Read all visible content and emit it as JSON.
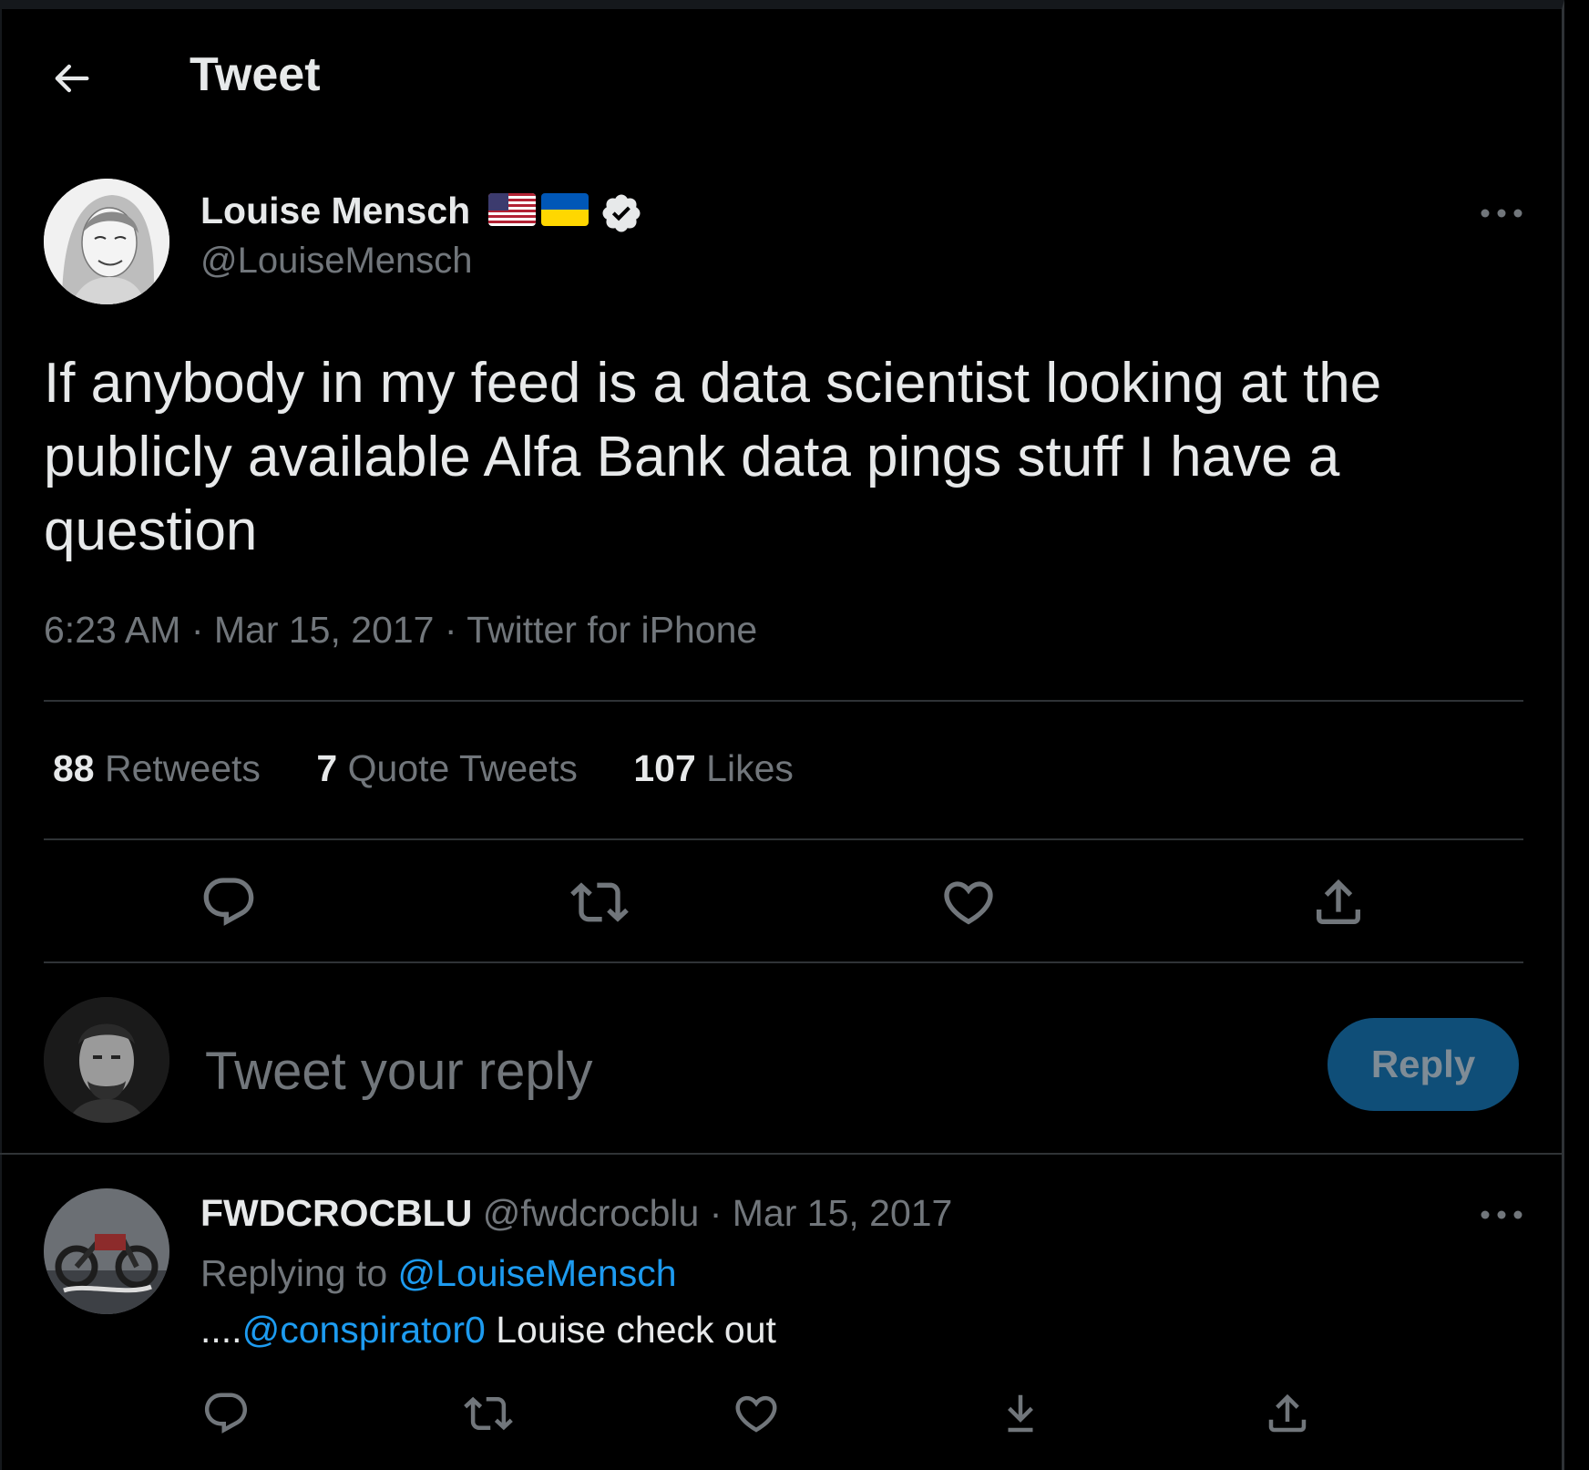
{
  "header": {
    "title": "Tweet",
    "back_icon": "back-arrow-icon"
  },
  "tweet": {
    "author": {
      "name": "Louise Mensch",
      "handle": "@LouiseMensch",
      "flags": [
        "us-flag-icon",
        "ukraine-flag-icon"
      ],
      "verified": true
    },
    "text": "If anybody in my feed is a data scientist looking at the publicly available Alfa Bank data pings stuff I have a question",
    "meta": {
      "time": "6:23 AM",
      "sep1": " · ",
      "date": "Mar 15, 2017",
      "sep2": " · ",
      "source": "Twitter for iPhone"
    },
    "stats": {
      "retweets_count": "88",
      "retweets_label": " Retweets",
      "quotes_count": "7",
      "quotes_label": " Quote Tweets",
      "likes_count": "107",
      "likes_label": " Likes"
    },
    "actions": [
      "reply-icon",
      "retweet-icon",
      "like-icon",
      "share-icon"
    ]
  },
  "composer": {
    "placeholder": "Tweet your reply",
    "button_label": "Reply"
  },
  "reply": {
    "name": "FWDCROCBLU",
    "handle": " @fwdcrocblu",
    "sep": " · ",
    "date": "Mar 15, 2017",
    "replying_prefix": "Replying to ",
    "replying_to": "@LouiseMensch",
    "text_prefix": "....",
    "mention": "@conspirator0",
    "text_suffix": " Louise check out",
    "actions": [
      "reply-icon",
      "retweet-icon",
      "like-icon",
      "download-icon",
      "share-icon"
    ]
  },
  "colors": {
    "background": "#000000",
    "text": "#e7e9ea",
    "secondary": "#71767b",
    "accent": "#1d9bf0",
    "reply_button": "#0f4e78",
    "divider": "#2f3336"
  }
}
